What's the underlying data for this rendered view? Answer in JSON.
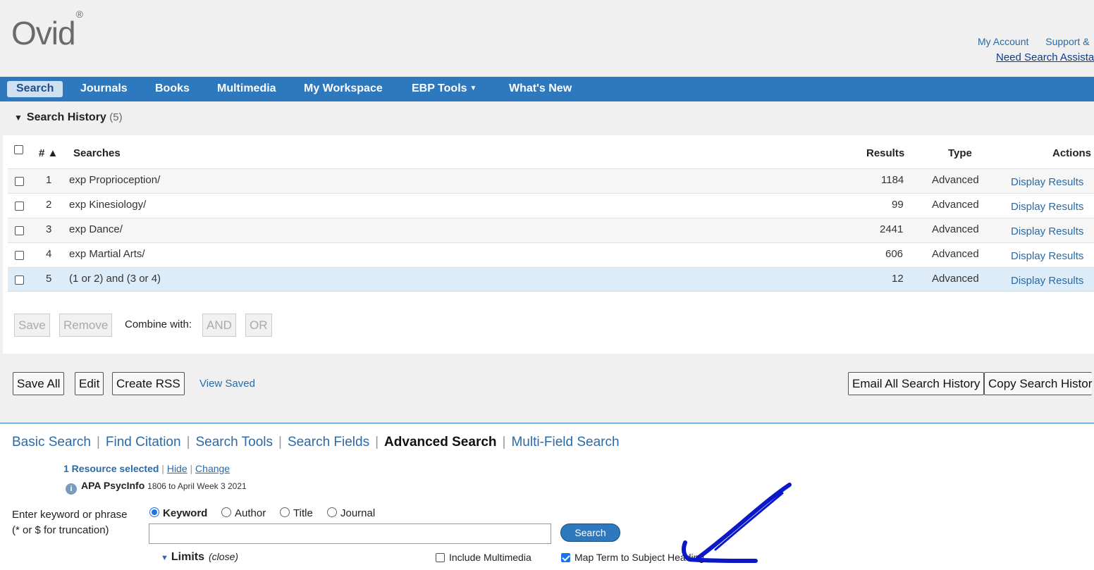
{
  "header": {
    "logo": "Ovid",
    "logo_mark": "®",
    "links": [
      "My Account",
      "Support &"
    ],
    "help_link": "Need Search Assista"
  },
  "nav": {
    "items": [
      "Search",
      "Journals",
      "Books",
      "Multimedia",
      "My Workspace",
      "EBP Tools",
      "What's New"
    ],
    "active": "Search"
  },
  "history": {
    "title": "Search History",
    "count": "(5)",
    "columns": {
      "num": "#",
      "sort_arrow": "▲",
      "searches": "Searches",
      "results": "Results",
      "type": "Type",
      "actions": "Actions"
    },
    "rows": [
      {
        "num": "1",
        "search": "exp Proprioception/",
        "results": "1184",
        "type": "Advanced",
        "action": "Display Results"
      },
      {
        "num": "2",
        "search": "exp Kinesiology/",
        "results": "99",
        "type": "Advanced",
        "action": "Display Results"
      },
      {
        "num": "3",
        "search": "exp Dance/",
        "results": "2441",
        "type": "Advanced",
        "action": "Display Results"
      },
      {
        "num": "4",
        "search": "exp Martial Arts/",
        "results": "606",
        "type": "Advanced",
        "action": "Display Results"
      },
      {
        "num": "5",
        "search": "(1 or 2) and (3 or 4)",
        "results": "12",
        "type": "Advanced",
        "action": "Display Results"
      }
    ],
    "buttons": {
      "save": "Save",
      "remove": "Remove",
      "combine_label": "Combine with:",
      "and": "AND",
      "or": "OR"
    },
    "footer": {
      "save_all": "Save All",
      "edit": "Edit",
      "create_rss": "Create RSS",
      "view_saved": "View Saved",
      "email_all": "Email All Search History",
      "copy": "Copy Search Histor"
    }
  },
  "search_tabs": {
    "items": [
      "Basic Search",
      "Find Citation",
      "Search Tools",
      "Search Fields",
      "Advanced Search",
      "Multi-Field Search"
    ],
    "active": "Advanced Search"
  },
  "resource": {
    "selected": "1 Resource selected",
    "hide": "Hide",
    "change": "Change",
    "db_name": "APA PsycInfo",
    "db_dates": "1806 to April Week 3 2021"
  },
  "form": {
    "label_line1": "Enter keyword or phrase",
    "label_line2": "(* or $ for truncation)",
    "radios": [
      "Keyword",
      "Author",
      "Title",
      "Journal"
    ],
    "selected_radio": "Keyword",
    "input_value": "",
    "search_button": "Search",
    "limits": "Limits",
    "limits_close": "(close)",
    "include_multimedia": "Include Multimedia",
    "map_term": "Map Term to Subject Heading",
    "map_term_checked": true
  }
}
